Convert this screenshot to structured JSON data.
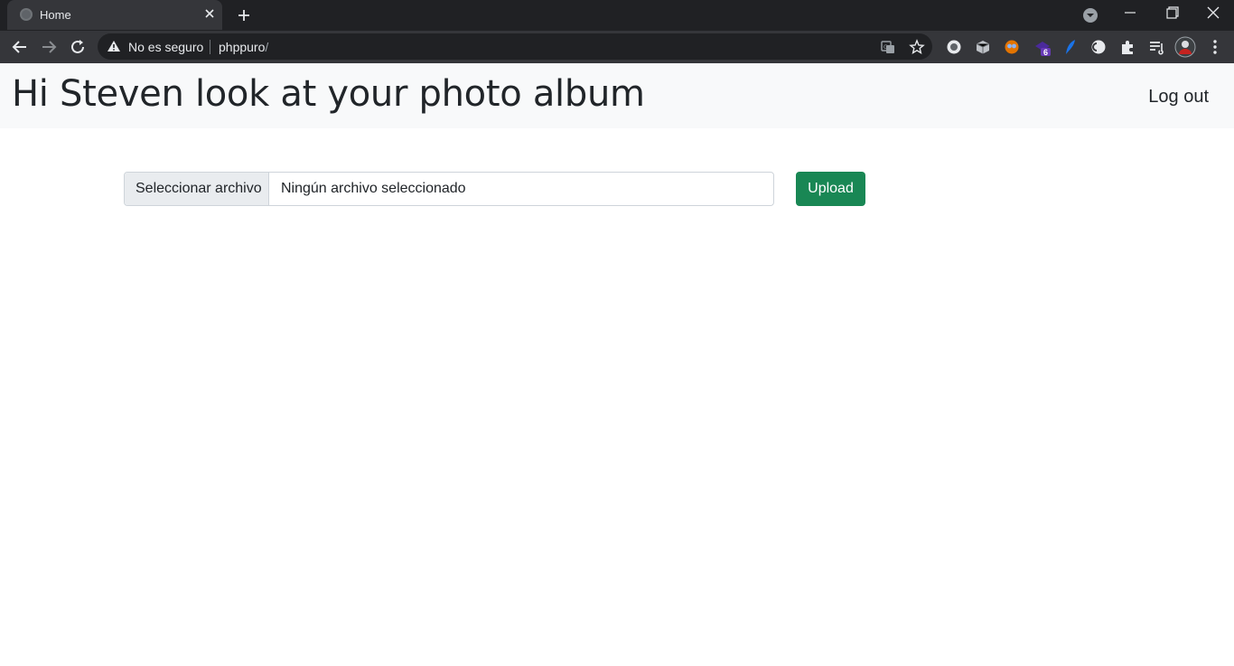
{
  "browser": {
    "tab_title": "Home",
    "security_label": "No es seguro",
    "url_host": "phppuro",
    "url_path": "/",
    "extension_badge": "6"
  },
  "navbar": {
    "title": "Hi Steven look at your photo album",
    "logout_label": "Log out"
  },
  "upload": {
    "choose_file_label": "Seleccionar archivo",
    "file_status": "Ningún archivo seleccionado",
    "upload_label": "Upload"
  },
  "colors": {
    "upload_button": "#198754",
    "navbar_bg": "#f8f9fa",
    "chrome_dark": "#202124",
    "chrome_toolbar": "#35363a"
  }
}
